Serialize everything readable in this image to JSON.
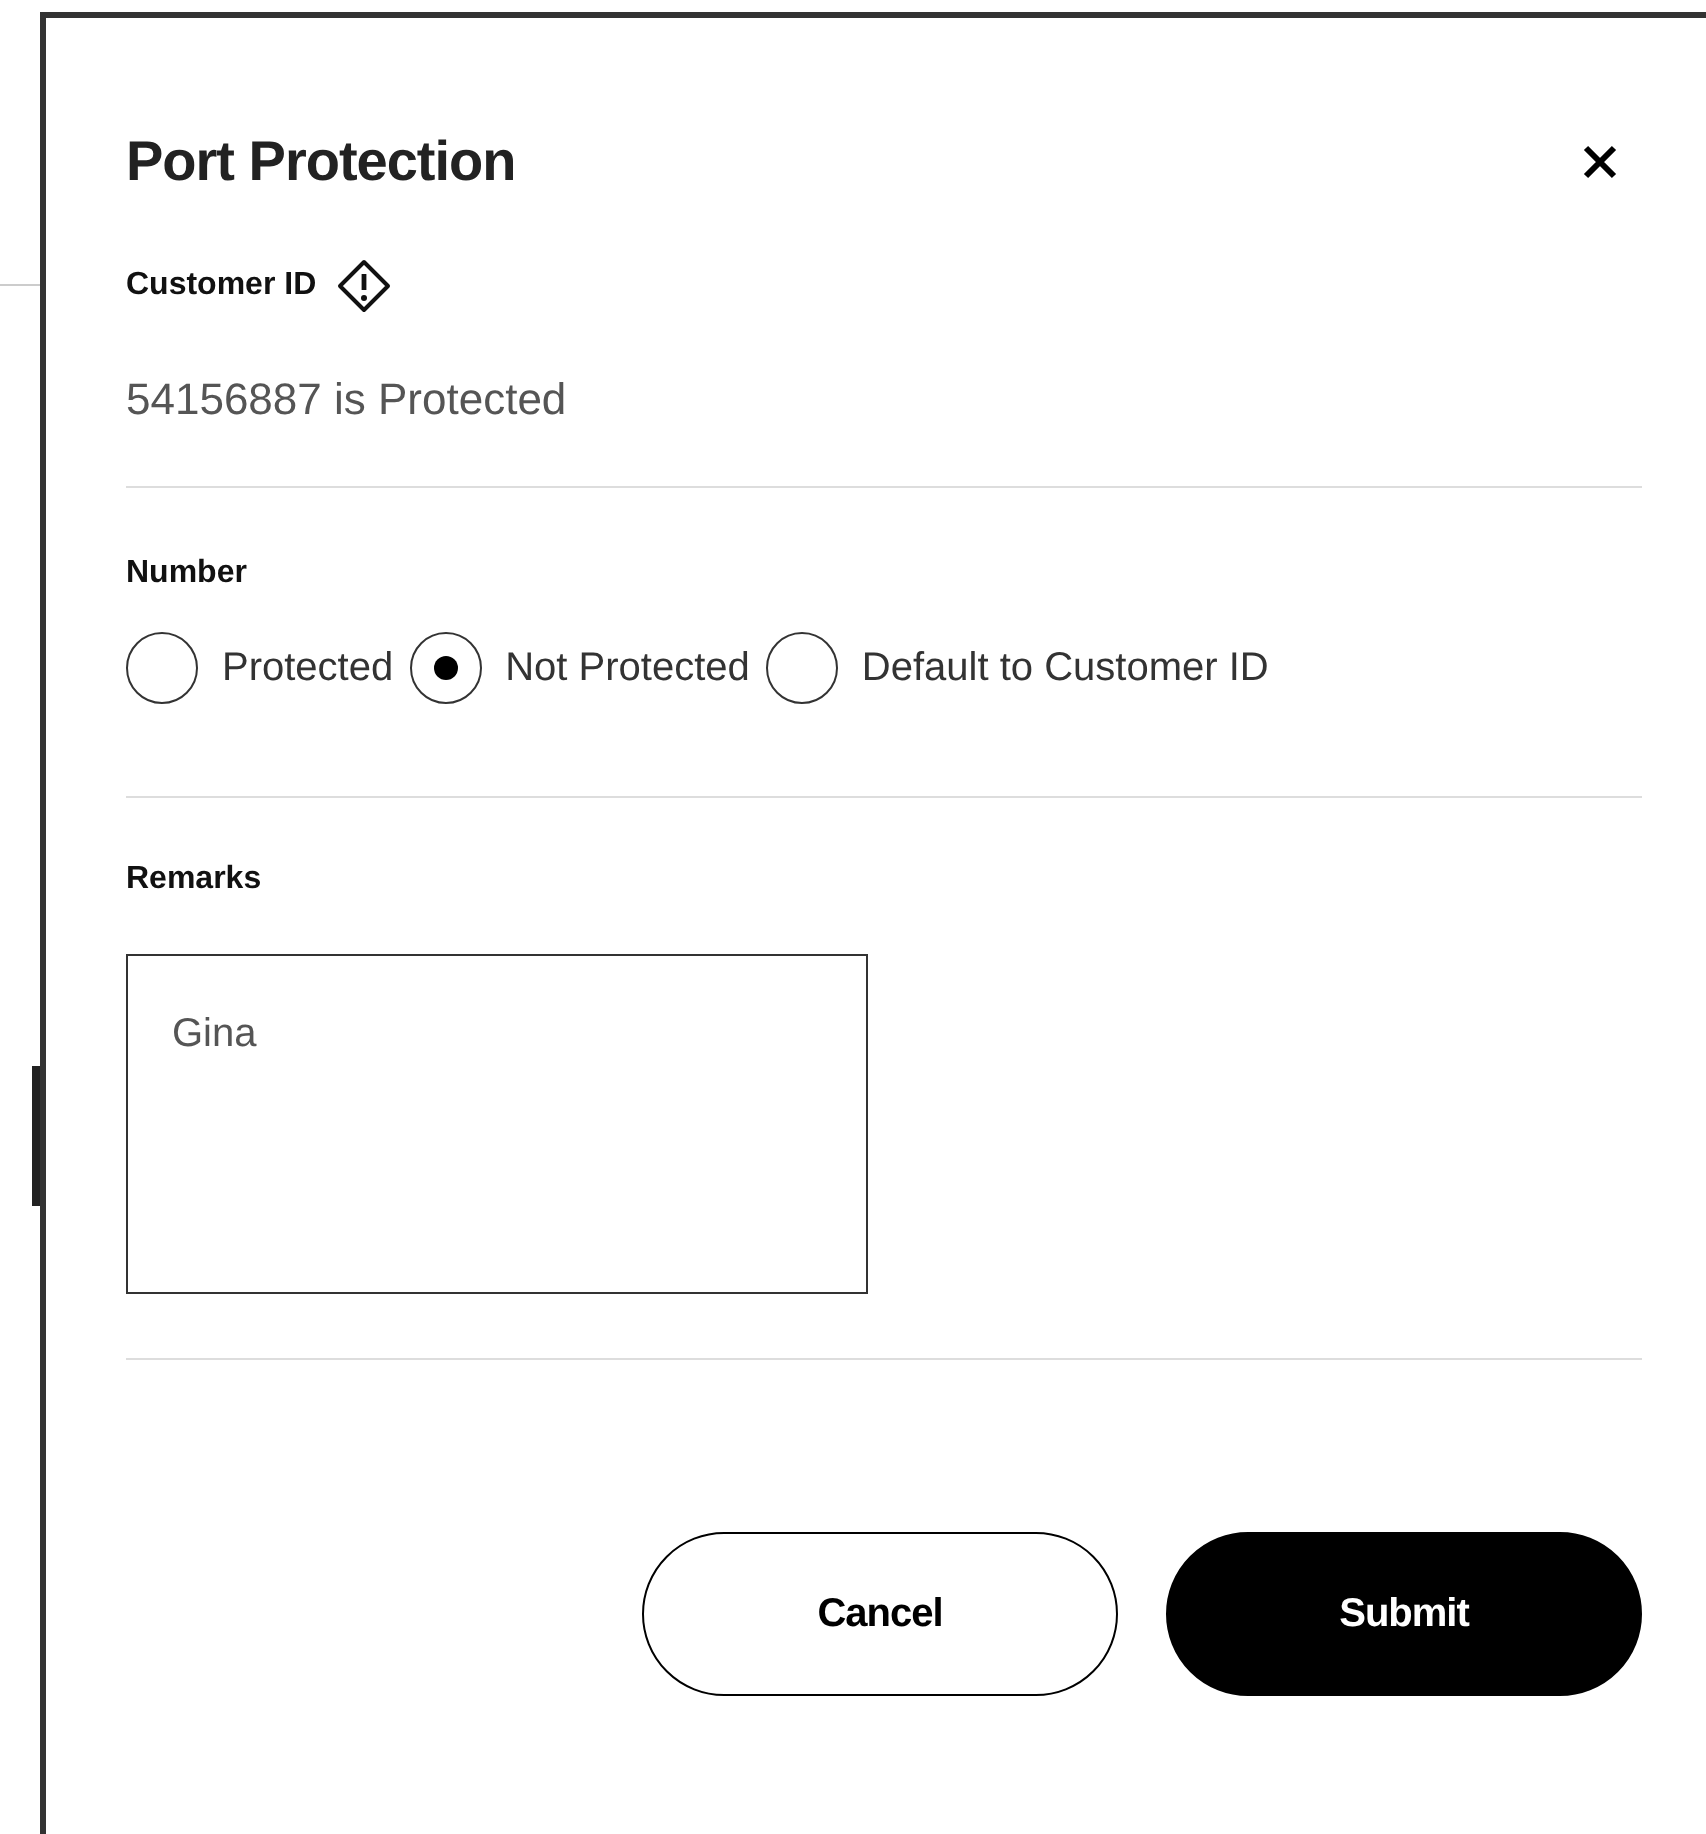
{
  "dialog": {
    "title": "Port Protection"
  },
  "customer_id": {
    "label": "Customer ID",
    "status": "54156887 is Protected"
  },
  "number": {
    "label": "Number",
    "options": [
      {
        "label": "Protected",
        "selected": false
      },
      {
        "label": "Not Protected",
        "selected": true
      },
      {
        "label": "Default to Customer ID",
        "selected": false
      }
    ]
  },
  "remarks": {
    "label": "Remarks",
    "value": "Gina"
  },
  "buttons": [
    {
      "label": "Cancel",
      "kind": "secondary"
    },
    {
      "label": "Submit",
      "kind": "primary"
    }
  ]
}
